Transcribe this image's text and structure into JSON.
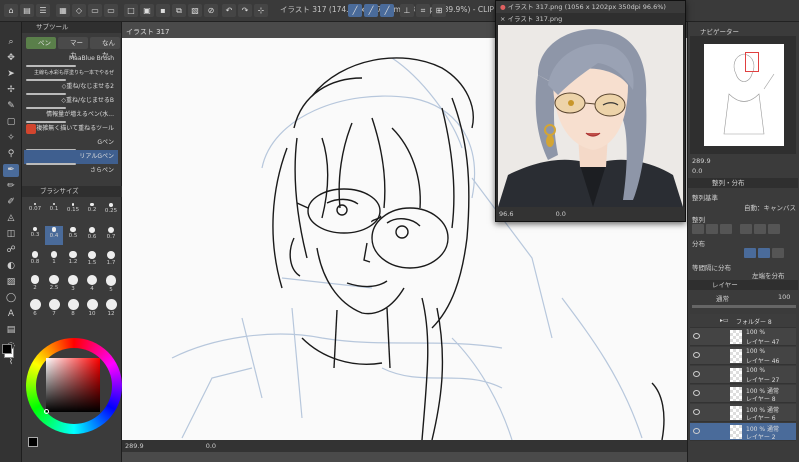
{
  "window": {
    "title": "イラスト 317 (174.32 x 247.32mm 350dpi 289.9%) - CLIP STUDIO PAINT"
  },
  "colors": {
    "accent": "#4a6b9a",
    "tab_green": "#5a7f4a",
    "canvas_bg": "#fafafa",
    "panel_bg": "#3b3b3b",
    "sketch_blue": "#b7c7dc",
    "line_black": "#1a1a1a"
  },
  "toolbar": {
    "icons": [
      "home-icon",
      "new-icon",
      "open-icon",
      "save-icon",
      "undo-icon",
      "redo-icon",
      "stroke-tool-icon",
      "ruler-icon",
      "snap-icon"
    ]
  },
  "subtool": {
    "header": "サブツール",
    "tabs": [
      "ペン",
      "マーカ",
      "なんか"
    ],
    "brushes": [
      "MaaBlue Brush",
      "主線も水彩も厚塗りも一本でやるぜ",
      "◇重ね/なじませる2",
      "◇重ね/なじませるB",
      "情報量が増えるペン(水...",
      "複雑無く描いて重ねるツール",
      "Gペン",
      "リアルGペン",
      "さらペン"
    ],
    "selected_brush_index": 7
  },
  "brush_size": {
    "header": "ブラシサイズ",
    "sizes": [
      "0.07",
      "0.1",
      "0.15",
      "0.2",
      "0.25",
      "0.3",
      "0.4",
      "0.5",
      "0.6",
      "0.7",
      "0.8",
      "1",
      "1.2",
      "1.5",
      "1.7",
      "2",
      "2.5",
      "3",
      "4",
      "5",
      "6",
      "7",
      "8",
      "10",
      "12"
    ],
    "selected_index": 6
  },
  "canvas": {
    "tab_label": "イラスト 317",
    "zoom": "289.9",
    "rotation": "0.0"
  },
  "reference_window": {
    "title": "イラスト 317.png (1056 x 1202px 350dpi 96.6%)",
    "tab_label": "イラスト 317.png",
    "zoom": "96.6",
    "rotation": "0.0"
  },
  "navigator": {
    "header": "ナビゲーター",
    "zoom": "289.9",
    "rotation": "0.0"
  },
  "align": {
    "header": "整列・分布",
    "align_ref_label": "整列基準",
    "align_ref_value": "自動：キャンバス",
    "align_label": "整列",
    "distribute_label": "分布",
    "equal_spacing_label": "等間隔に分布",
    "equal_spacing_value": "左端を分布"
  },
  "layers": {
    "header": "レイヤー",
    "blend_mode": "通常",
    "opacity": "100",
    "folder_name": "フォルダー 8",
    "items": [
      {
        "pct": "100 %",
        "name": "レイヤー 47"
      },
      {
        "pct": "100 %",
        "name": "レイヤー 46"
      },
      {
        "pct": "100 %",
        "name": "レイヤー 27"
      },
      {
        "pct": "100 % 通常",
        "name": "レイヤー 8"
      },
      {
        "pct": "100 % 通常",
        "name": "レイヤー 6"
      },
      {
        "pct": "100 % 通常",
        "name": "レイヤー 2"
      }
    ],
    "selected_index": 5
  }
}
